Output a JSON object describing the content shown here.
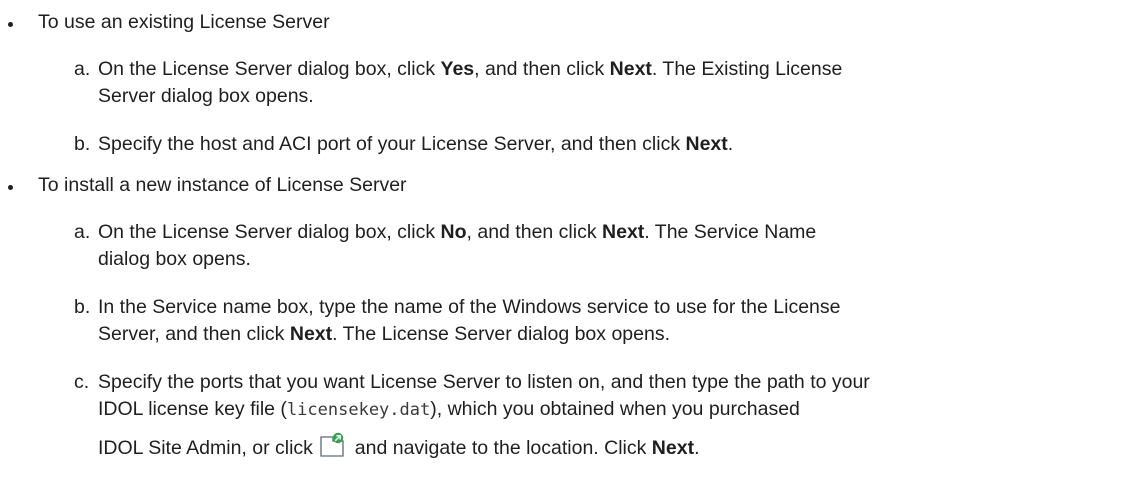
{
  "sections": [
    {
      "heading": "To use an existing License Server",
      "steps": [
        {
          "marker": "a.",
          "lines": [
            [
              "On the License Server dialog box, click ",
              {
                "b": "Yes"
              },
              ", and then click ",
              {
                "b": "Next"
              },
              ". The Existing License"
            ],
            [
              "Server dialog box opens."
            ]
          ]
        },
        {
          "marker": "b.",
          "lines": [
            [
              "Specify the host and ACI port of your License Server, and then click ",
              {
                "b": "Next"
              },
              "."
            ]
          ]
        }
      ]
    },
    {
      "heading": "To install a new instance of License Server",
      "steps": [
        {
          "marker": "a.",
          "lines": [
            [
              "On the License Server dialog box, click ",
              {
                "b": "No"
              },
              ", and then click ",
              {
                "b": "Next"
              },
              ". The Service Name"
            ],
            [
              "dialog box opens."
            ]
          ]
        },
        {
          "marker": "b.",
          "lines": [
            [
              "In the Service name box, type the name of the Windows service to use for the License"
            ],
            [
              "Server, and then click ",
              {
                "b": "Next"
              },
              ". The License Server dialog box opens."
            ]
          ]
        },
        {
          "marker": "c.",
          "lines": [
            [
              "Specify the ports that you want License Server to listen on, and then type the path to your"
            ],
            [
              "IDOL license key file (",
              {
                "code": "licensekey.dat"
              },
              "), which you obtained when you purchased"
            ],
            [
              "IDOL Site Admin, or click ",
              {
                "icon": "browse-folder-icon"
              },
              " and navigate to the location. Click ",
              {
                "b": "Next"
              },
              "."
            ]
          ]
        }
      ]
    }
  ]
}
